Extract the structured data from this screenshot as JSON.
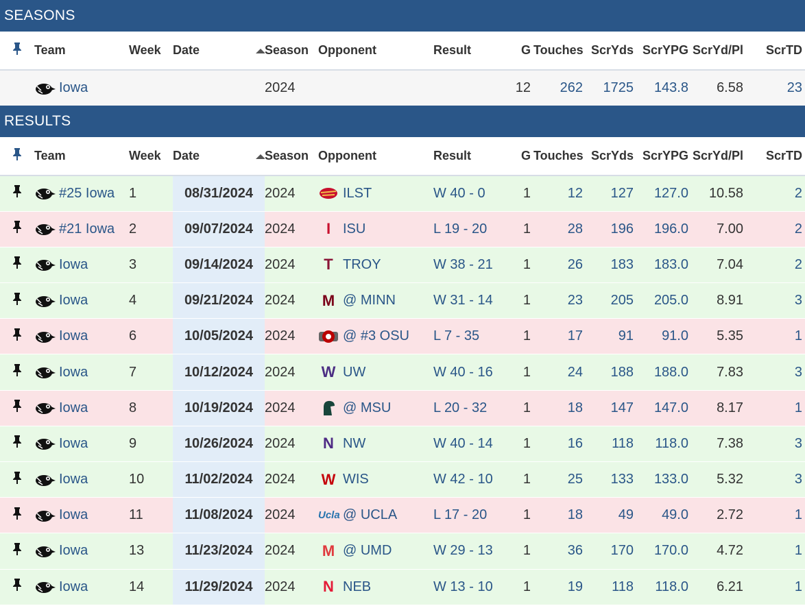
{
  "seasons": {
    "header": "SEASONS",
    "row": {
      "team": "Iowa",
      "season": "2024",
      "g": "12",
      "touches": "262",
      "scryds": "1725",
      "scrypg": "143.8",
      "scrydpl": "6.58",
      "scrtd": "23"
    }
  },
  "results": {
    "header": "RESULTS"
  },
  "columns": {
    "team": "Team",
    "week": "Week",
    "date": "Date",
    "season": "Season",
    "opponent": "Opponent",
    "result": "Result",
    "g": "G",
    "touches": "Touches",
    "scryds": "ScrYds",
    "scrypg": "ScrYPG",
    "scrydpl": "ScrYd/Pl",
    "scrtd": "ScrTD"
  },
  "rows": [
    {
      "outcome": "win",
      "team": "#25 Iowa",
      "week": "1",
      "date": "08/31/2024",
      "season": "2024",
      "logo": "cyclone-logo",
      "opponent": "ILST",
      "result": "W 40 - 0",
      "g": "1",
      "touches": "12",
      "scryds": "127",
      "scrypg": "127.0",
      "scrydpl": "10.58",
      "scrtd": "2"
    },
    {
      "outcome": "loss",
      "team": "#21 Iowa",
      "week": "2",
      "date": "09/07/2024",
      "season": "2024",
      "logo": "isu-logo",
      "opponent": "ISU",
      "result": "L 19 - 20",
      "g": "1",
      "touches": "28",
      "scryds": "196",
      "scrypg": "196.0",
      "scrydpl": "7.00",
      "scrtd": "2"
    },
    {
      "outcome": "win",
      "team": "Iowa",
      "week": "3",
      "date": "09/14/2024",
      "season": "2024",
      "logo": "troy-logo",
      "opponent": "TROY",
      "result": "W 38 - 21",
      "g": "1",
      "touches": "26",
      "scryds": "183",
      "scrypg": "183.0",
      "scrydpl": "7.04",
      "scrtd": "2"
    },
    {
      "outcome": "win",
      "team": "Iowa",
      "week": "4",
      "date": "09/21/2024",
      "season": "2024",
      "logo": "minn-logo",
      "opponent": "@ MINN",
      "result": "W 31 - 14",
      "g": "1",
      "touches": "23",
      "scryds": "205",
      "scrypg": "205.0",
      "scrydpl": "8.91",
      "scrtd": "3"
    },
    {
      "outcome": "loss",
      "team": "Iowa",
      "week": "6",
      "date": "10/05/2024",
      "season": "2024",
      "logo": "osu-logo",
      "opponent": "@ #3 OSU",
      "result": "L 7 - 35",
      "g": "1",
      "touches": "17",
      "scryds": "91",
      "scrypg": "91.0",
      "scrydpl": "5.35",
      "scrtd": "1"
    },
    {
      "outcome": "win",
      "team": "Iowa",
      "week": "7",
      "date": "10/12/2024",
      "season": "2024",
      "logo": "uw-logo",
      "opponent": "UW",
      "result": "W 40 - 16",
      "g": "1",
      "touches": "24",
      "scryds": "188",
      "scrypg": "188.0",
      "scrydpl": "7.83",
      "scrtd": "3"
    },
    {
      "outcome": "loss",
      "team": "Iowa",
      "week": "8",
      "date": "10/19/2024",
      "season": "2024",
      "logo": "msu-logo",
      "opponent": "@ MSU",
      "result": "L 20 - 32",
      "g": "1",
      "touches": "18",
      "scryds": "147",
      "scrypg": "147.0",
      "scrydpl": "8.17",
      "scrtd": "1"
    },
    {
      "outcome": "win",
      "team": "Iowa",
      "week": "9",
      "date": "10/26/2024",
      "season": "2024",
      "logo": "nw-logo",
      "opponent": "NW",
      "result": "W 40 - 14",
      "g": "1",
      "touches": "16",
      "scryds": "118",
      "scrypg": "118.0",
      "scrydpl": "7.38",
      "scrtd": "3"
    },
    {
      "outcome": "win",
      "team": "Iowa",
      "week": "10",
      "date": "11/02/2024",
      "season": "2024",
      "logo": "wis-logo",
      "opponent": "WIS",
      "result": "W 42 - 10",
      "g": "1",
      "touches": "25",
      "scryds": "133",
      "scrypg": "133.0",
      "scrydpl": "5.32",
      "scrtd": "3"
    },
    {
      "outcome": "loss",
      "team": "Iowa",
      "week": "11",
      "date": "11/08/2024",
      "season": "2024",
      "logo": "ucla-logo",
      "opponent": "@ UCLA",
      "result": "L 17 - 20",
      "g": "1",
      "touches": "18",
      "scryds": "49",
      "scrypg": "49.0",
      "scrydpl": "2.72",
      "scrtd": "1"
    },
    {
      "outcome": "win",
      "team": "Iowa",
      "week": "13",
      "date": "11/23/2024",
      "season": "2024",
      "logo": "umd-logo",
      "opponent": "@ UMD",
      "result": "W 29 - 13",
      "g": "1",
      "touches": "36",
      "scryds": "170",
      "scrypg": "170.0",
      "scrydpl": "4.72",
      "scrtd": "1"
    },
    {
      "outcome": "win",
      "team": "Iowa",
      "week": "14",
      "date": "11/29/2024",
      "season": "2024",
      "logo": "neb-logo",
      "opponent": "NEB",
      "result": "W 13 - 10",
      "g": "1",
      "touches": "19",
      "scryds": "118",
      "scrypg": "118.0",
      "scrydpl": "6.21",
      "scrtd": "1"
    }
  ],
  "logos": {
    "isu-logo": "I",
    "minn-logo": "M",
    "nw-logo": "N",
    "wis-logo": "W",
    "uw-logo": "W",
    "umd-logo": "M",
    "neb-logo": "N",
    "ucla-logo": "Ucla",
    "troy-logo": "T"
  },
  "colors": {
    "header_bg": "#2a5688",
    "win_bg": "#e8f9e6",
    "loss_bg": "#fbe3e6",
    "date_bg": "#e2edf8",
    "link": "#2a5688"
  }
}
